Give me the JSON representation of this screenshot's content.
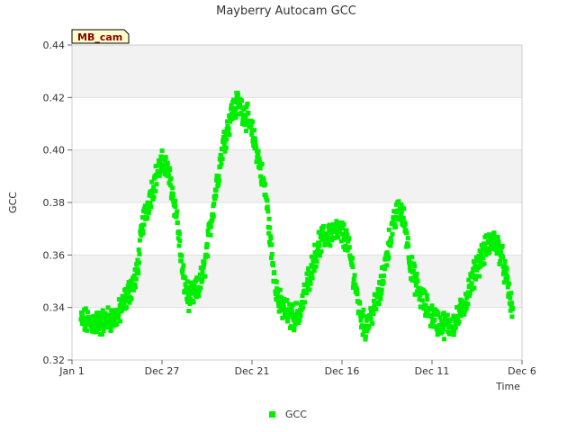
{
  "chart_data": {
    "type": "scatter",
    "title": "Mayberry Autocam GCC",
    "xlabel": "Time",
    "ylabel": "GCC",
    "badge": "MB_cam",
    "ylim": [
      0.32,
      0.44
    ],
    "yticks": [
      "0.32",
      "0.34",
      "0.36",
      "0.38",
      "0.40",
      "0.42",
      "0.44"
    ],
    "xticks": [
      "Jan 1",
      "Dec 27",
      "Dec 21",
      "Dec 16",
      "Dec 11",
      "Dec 6"
    ],
    "grid": true,
    "legend_position": "bottom",
    "colors": {
      "series": "#00ee00",
      "band": "#f2f2f2",
      "grid": "#e0e0e0",
      "badge_fill": "#ffffcc",
      "badge_text": "#8b0000"
    },
    "series": [
      {
        "name": "GCC",
        "x_unit": "days after Jan 1",
        "points": [
          [
            0,
            0.335
          ],
          [
            30,
            0.334
          ],
          [
            60,
            0.337
          ],
          [
            90,
            0.352
          ],
          [
            100,
            0.372
          ],
          [
            115,
            0.385
          ],
          [
            125,
            0.392
          ],
          [
            135,
            0.396
          ],
          [
            145,
            0.388
          ],
          [
            155,
            0.375
          ],
          [
            165,
            0.352
          ],
          [
            175,
            0.343
          ],
          [
            190,
            0.347
          ],
          [
            200,
            0.355
          ],
          [
            215,
            0.38
          ],
          [
            230,
            0.402
          ],
          [
            245,
            0.415
          ],
          [
            255,
            0.418
          ],
          [
            270,
            0.412
          ],
          [
            285,
            0.4
          ],
          [
            300,
            0.382
          ],
          [
            310,
            0.358
          ],
          [
            320,
            0.342
          ],
          [
            340,
            0.336
          ],
          [
            355,
            0.338
          ],
          [
            370,
            0.352
          ],
          [
            385,
            0.364
          ],
          [
            400,
            0.368
          ],
          [
            420,
            0.369
          ],
          [
            430,
            0.366
          ],
          [
            440,
            0.355
          ],
          [
            450,
            0.34
          ],
          [
            460,
            0.332
          ],
          [
            470,
            0.337
          ],
          [
            485,
            0.346
          ],
          [
            500,
            0.366
          ],
          [
            515,
            0.378
          ],
          [
            525,
            0.372
          ],
          [
            535,
            0.355
          ],
          [
            550,
            0.344
          ],
          [
            565,
            0.338
          ],
          [
            580,
            0.334
          ],
          [
            595,
            0.333
          ],
          [
            610,
            0.335
          ],
          [
            625,
            0.344
          ],
          [
            640,
            0.355
          ],
          [
            655,
            0.362
          ],
          [
            670,
            0.366
          ],
          [
            680,
            0.361
          ],
          [
            690,
            0.35
          ],
          [
            700,
            0.337
          ]
        ]
      }
    ]
  }
}
